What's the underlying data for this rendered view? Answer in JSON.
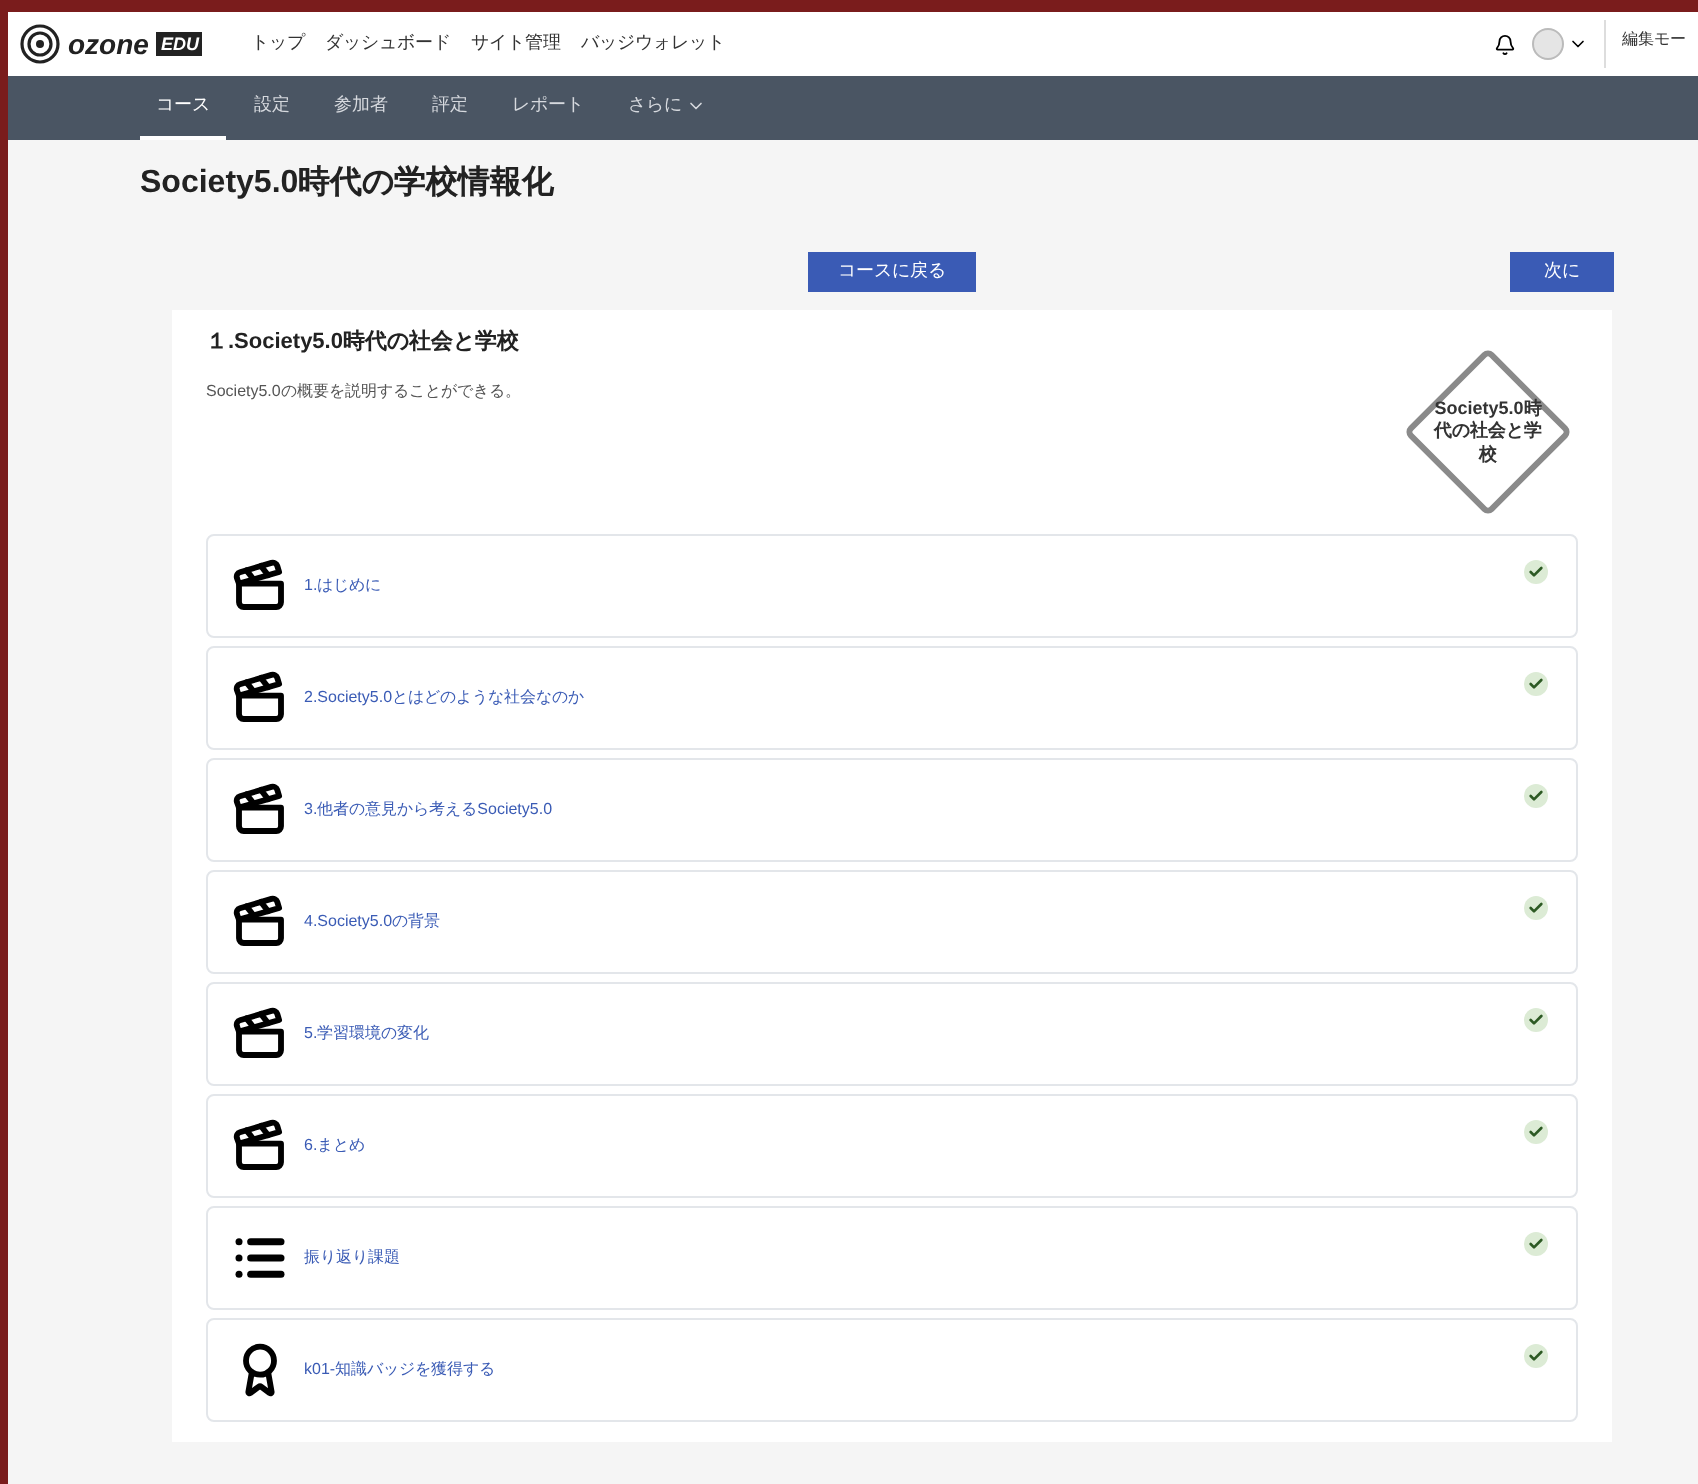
{
  "header": {
    "logo": "ozone",
    "logo_tag": "EDU",
    "nav": [
      "トップ",
      "ダッシュボード",
      "サイト管理",
      "バッジウォレット"
    ],
    "edit_mode": "編集モー"
  },
  "course_nav": [
    {
      "label": "コース",
      "selected": true
    },
    {
      "label": "設定",
      "selected": false
    },
    {
      "label": "参加者",
      "selected": false
    },
    {
      "label": "評定",
      "selected": false
    },
    {
      "label": "レポート",
      "selected": false
    },
    {
      "label": "さらに",
      "selected": false,
      "dropdown": true
    }
  ],
  "page_title": "Society5.0時代の学校情報化",
  "buttons": {
    "back": "コースに戻る",
    "next": "次に"
  },
  "section": {
    "title": "１.Society5.0時代の社会と学校",
    "summary": "Society5.0の概要を説明することができる。",
    "badge_label": "Society5.0時代の社会と学校",
    "activities": [
      {
        "kind": "video",
        "title": "1.はじめに",
        "completed": true
      },
      {
        "kind": "video",
        "title": "2.Society5.0とはどのような社会なのか",
        "completed": true
      },
      {
        "kind": "video",
        "title": "3.他者の意見から考えるSociety5.0",
        "completed": true
      },
      {
        "kind": "video",
        "title": "4.Society5.0の背景",
        "completed": true
      },
      {
        "kind": "video",
        "title": "5.学習環境の変化",
        "completed": true
      },
      {
        "kind": "video",
        "title": "6.まとめ",
        "completed": true
      },
      {
        "kind": "list",
        "title": "振り返り課題",
        "completed": true
      },
      {
        "kind": "badge",
        "title": "k01-知識バッジを獲得する",
        "completed": true
      }
    ]
  }
}
